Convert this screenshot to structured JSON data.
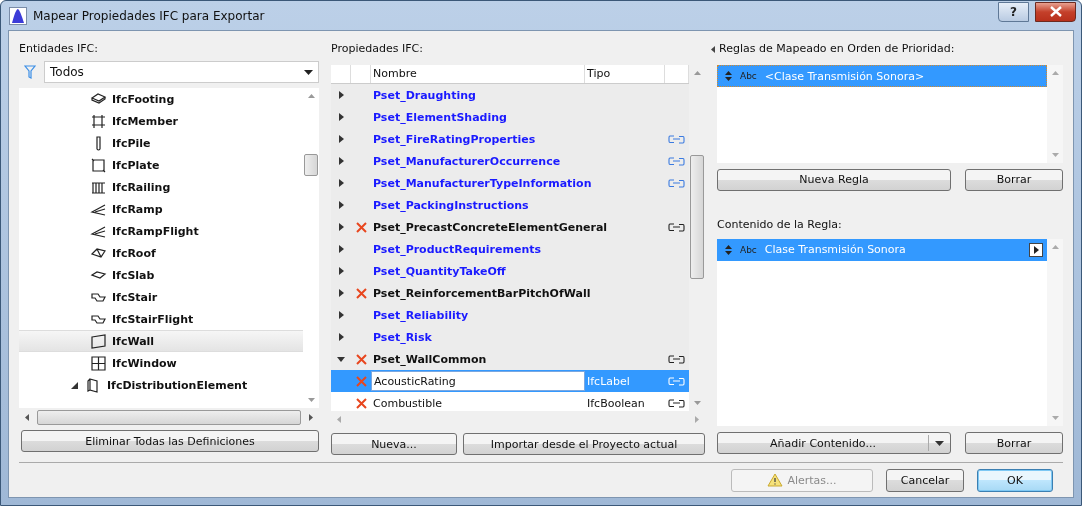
{
  "window": {
    "title": "Mapear Propiedades IFC para Exportar",
    "help": "?"
  },
  "entities_panel": {
    "label": "Entidades IFC:",
    "filter": "Todos",
    "items": [
      {
        "name": "IfcFooting",
        "kind": "element",
        "selected": false
      },
      {
        "name": "IfcMember",
        "kind": "element",
        "selected": false
      },
      {
        "name": "IfcPile",
        "kind": "element",
        "selected": false
      },
      {
        "name": "IfcPlate",
        "kind": "element",
        "selected": false
      },
      {
        "name": "IfcRailing",
        "kind": "element",
        "selected": false
      },
      {
        "name": "IfcRamp",
        "kind": "element",
        "selected": false
      },
      {
        "name": "IfcRampFlight",
        "kind": "element",
        "selected": false
      },
      {
        "name": "IfcRoof",
        "kind": "element",
        "selected": false
      },
      {
        "name": "IfcSlab",
        "kind": "element",
        "selected": false
      },
      {
        "name": "IfcStair",
        "kind": "element",
        "selected": false
      },
      {
        "name": "IfcStairFlight",
        "kind": "element",
        "selected": false
      },
      {
        "name": "IfcWall",
        "kind": "element",
        "selected": true
      },
      {
        "name": "IfcWindow",
        "kind": "element",
        "selected": false
      },
      {
        "name": "IfcDistributionElement",
        "kind": "group",
        "expanded": true,
        "selected": false
      }
    ],
    "button": "Eliminar Todas las Definiciones"
  },
  "properties_panel": {
    "label": "Propiedades IFC:",
    "columns": [
      "Nombre",
      "Tipo"
    ],
    "rows": [
      {
        "name": "Pset_Draughting",
        "kind": "pset",
        "expanded": false,
        "missing": false,
        "linked": false,
        "selected": false
      },
      {
        "name": "Pset_ElementShading",
        "kind": "pset",
        "expanded": false,
        "missing": false,
        "linked": false,
        "selected": false
      },
      {
        "name": "Pset_FireRatingProperties",
        "kind": "pset",
        "expanded": false,
        "missing": false,
        "linked": true,
        "selected": false
      },
      {
        "name": "Pset_ManufacturerOccurrence",
        "kind": "pset",
        "expanded": false,
        "missing": false,
        "linked": true,
        "selected": false
      },
      {
        "name": "Pset_ManufacturerTypeInformation",
        "kind": "pset",
        "expanded": false,
        "missing": false,
        "linked": true,
        "selected": false
      },
      {
        "name": "Pset_PackingInstructions",
        "kind": "pset",
        "expanded": false,
        "missing": false,
        "linked": false,
        "selected": false
      },
      {
        "name": "Pset_PrecastConcreteElementGeneral",
        "kind": "pset",
        "expanded": false,
        "missing": true,
        "linked": true,
        "selected": false
      },
      {
        "name": "Pset_ProductRequirements",
        "kind": "pset",
        "expanded": false,
        "missing": false,
        "linked": false,
        "selected": false
      },
      {
        "name": "Pset_QuantityTakeOff",
        "kind": "pset",
        "expanded": false,
        "missing": false,
        "linked": false,
        "selected": false
      },
      {
        "name": "Pset_ReinforcementBarPitchOfWall",
        "kind": "pset",
        "expanded": false,
        "missing": true,
        "linked": false,
        "selected": false
      },
      {
        "name": "Pset_Reliability",
        "kind": "pset",
        "expanded": false,
        "missing": false,
        "linked": false,
        "selected": false
      },
      {
        "name": "Pset_Risk",
        "kind": "pset",
        "expanded": false,
        "missing": false,
        "linked": false,
        "selected": false
      },
      {
        "name": "Pset_WallCommon",
        "kind": "pset",
        "expanded": true,
        "missing": true,
        "linked": true,
        "selected": false
      },
      {
        "name": "AcousticRating",
        "kind": "property",
        "type": "IfcLabel",
        "missing": true,
        "linked": true,
        "selected": true
      },
      {
        "name": "Combustible",
        "kind": "property",
        "type": "IfcBoolean",
        "missing": true,
        "linked": true,
        "selected": false
      }
    ],
    "buttons": [
      "Nueva...",
      "Importar desde el Proyecto actual"
    ]
  },
  "rules_panel": {
    "label": "Reglas de Mapeado en Orden de Prioridad:",
    "rules": [
      {
        "badge": "Abc",
        "text": "<Clase Transmisión Sonora>",
        "selected": true
      }
    ],
    "buttons": [
      "Nueva Regla",
      "Borrar"
    ]
  },
  "content_panel": {
    "label": "Contenido de la Regla:",
    "items": [
      {
        "badge": "Abc",
        "text": "Clase Transmisión Sonora",
        "selected": true
      }
    ],
    "buttons": [
      "Añadir Contenido...",
      "Borrar"
    ]
  },
  "footer": {
    "buttons": [
      {
        "label": "Alertas...",
        "disabled": true,
        "kind": "alert"
      },
      {
        "label": "Cancelar",
        "disabled": false,
        "kind": "plain"
      },
      {
        "label": "OK",
        "disabled": false,
        "kind": "default"
      }
    ]
  }
}
